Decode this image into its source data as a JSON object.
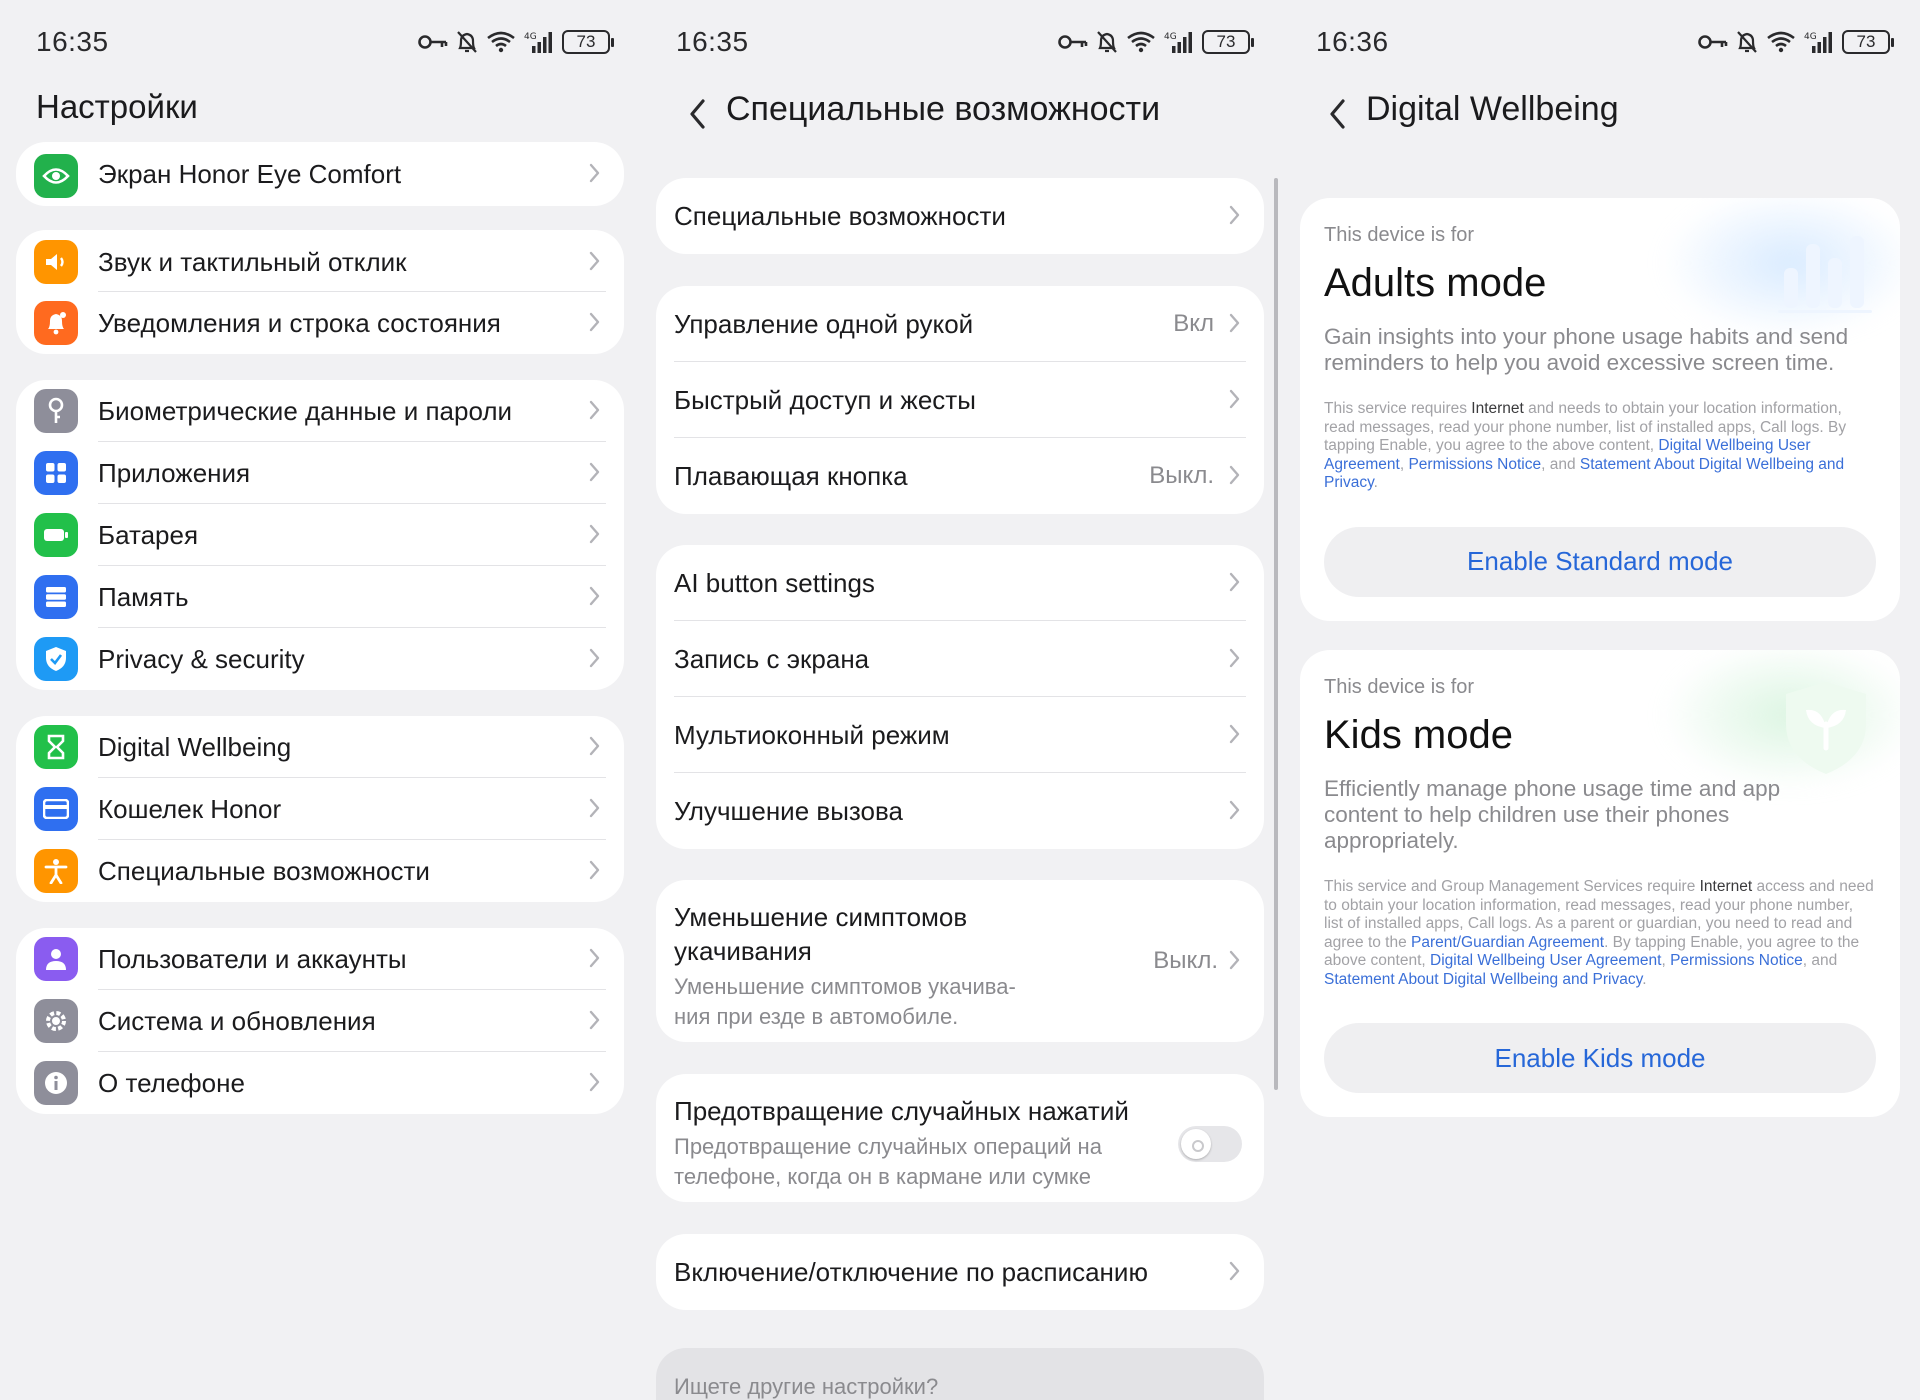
{
  "panels": [
    {
      "status": {
        "time": "16:35",
        "battery": "73"
      },
      "title": "Настройки",
      "groups": [
        [
          {
            "label": "Экран Honor Eye Comfort",
            "icon": "eye-icon",
            "color": "#22b14c"
          }
        ],
        [
          {
            "label": "Звук и тактильный отклик",
            "icon": "sound-icon",
            "color": "#ff9500"
          },
          {
            "label": "Уведомления и строка состояния",
            "icon": "bell-icon",
            "color": "#ff6a1f"
          }
        ],
        [
          {
            "label": "Биометрические данные и пароли",
            "icon": "key-icon",
            "color": "#8e8e9a"
          },
          {
            "label": "Приложения",
            "icon": "apps-grid-icon",
            "color": "#2f6ff0"
          },
          {
            "label": "Батарея",
            "icon": "battery-icon",
            "color": "#22c04a"
          },
          {
            "label": "Память",
            "icon": "storage-icon",
            "color": "#2f6ff0"
          },
          {
            "label": "Privacy & security",
            "icon": "shield-check-icon",
            "color": "#1e9af5"
          }
        ],
        [
          {
            "label": "Digital Wellbeing",
            "icon": "hourglass-icon",
            "color": "#22c04a"
          },
          {
            "label": "Кошелек Honor",
            "icon": "wallet-icon",
            "color": "#2f6ff0"
          },
          {
            "label": "Специальные возможности",
            "icon": "accessibility-icon",
            "color": "#ff9500"
          }
        ],
        [
          {
            "label": "Пользователи и аккаунты",
            "icon": "user-icon",
            "color": "#8a5cf0"
          },
          {
            "label": "Система и обновления",
            "icon": "gear-icon",
            "color": "#8e8e9a"
          },
          {
            "label": "О телефоне",
            "icon": "info-icon",
            "color": "#8e8e9a"
          }
        ]
      ]
    },
    {
      "status": {
        "time": "16:35",
        "battery": "73"
      },
      "title": "Специальные возможности",
      "groups": [
        [
          {
            "label": "Специальные возможности"
          }
        ],
        [
          {
            "label": "Управление одной рукой",
            "value": "Вкл"
          },
          {
            "label": "Быстрый доступ и жесты"
          },
          {
            "label": "Плавающая кнопка",
            "value": "Выкл."
          }
        ],
        [
          {
            "label": "AI button settings"
          },
          {
            "label": "Запись с экрана"
          },
          {
            "label": "Мультиоконный режим"
          },
          {
            "label": "Улучшение вызова"
          }
        ]
      ],
      "motion": {
        "title": "Уменьшение симптомов укачивания",
        "subtitle": "Уменьшение симптомов укачива-ния при езде в автомобиле.",
        "value": "Выкл."
      },
      "accidental": {
        "title": "Предотвращение случайных нажатий",
        "subtitle": "Предотвращение случайных операций на телефоне, когда он в кармане или сумке",
        "enabled": false
      },
      "schedule": {
        "label": "Включение/отключение по расписанию"
      },
      "search_hint": "Ищете другие настройки?"
    },
    {
      "status": {
        "time": "16:36",
        "battery": "73"
      },
      "title": "Digital Wellbeing",
      "adults": {
        "small": "This device is for",
        "title": "Adults mode",
        "desc": "Gain insights into your phone usage habits and send reminders to help you avoid excessive screen time.",
        "fine": {
          "p1": "This service requires ",
          "internet": "Internet",
          "p2": " and needs to obtain your location information, read messages, read your phone number, list of installed apps, Call logs. By tapping Enable, you agree to the above content, ",
          "l1": "Digital Wellbeing User Agreement",
          "c1": ", ",
          "l2": "Permissions Notice",
          "c2": ", and ",
          "l3": "Statement About Digital Wellbeing and Privacy",
          "end": "."
        },
        "button": "Enable Standard mode"
      },
      "kids": {
        "small": "This device is for",
        "title": "Kids mode",
        "desc": "Efficiently manage phone usage time and app content to help children use their phones appropriately.",
        "fine": {
          "p1": "This service and Group Management Services require ",
          "internet": "Internet",
          "p2": " access and need to obtain your location information, read messages, read your phone number, list of installed apps, Call logs. As a parent or guardian, you need to read and agree to the ",
          "l0": "Parent/Guardian Agreement",
          "p3": ". By tapping Enable, you agree to the above content, ",
          "l1": "Digital Wellbeing User Agreement",
          "c1": ", ",
          "l2": "Permissions Notice",
          "c2": ", and ",
          "l3": "Statement About Digital Wellbeing and Privacy",
          "end": "."
        },
        "button": "Enable Kids mode"
      }
    }
  ]
}
